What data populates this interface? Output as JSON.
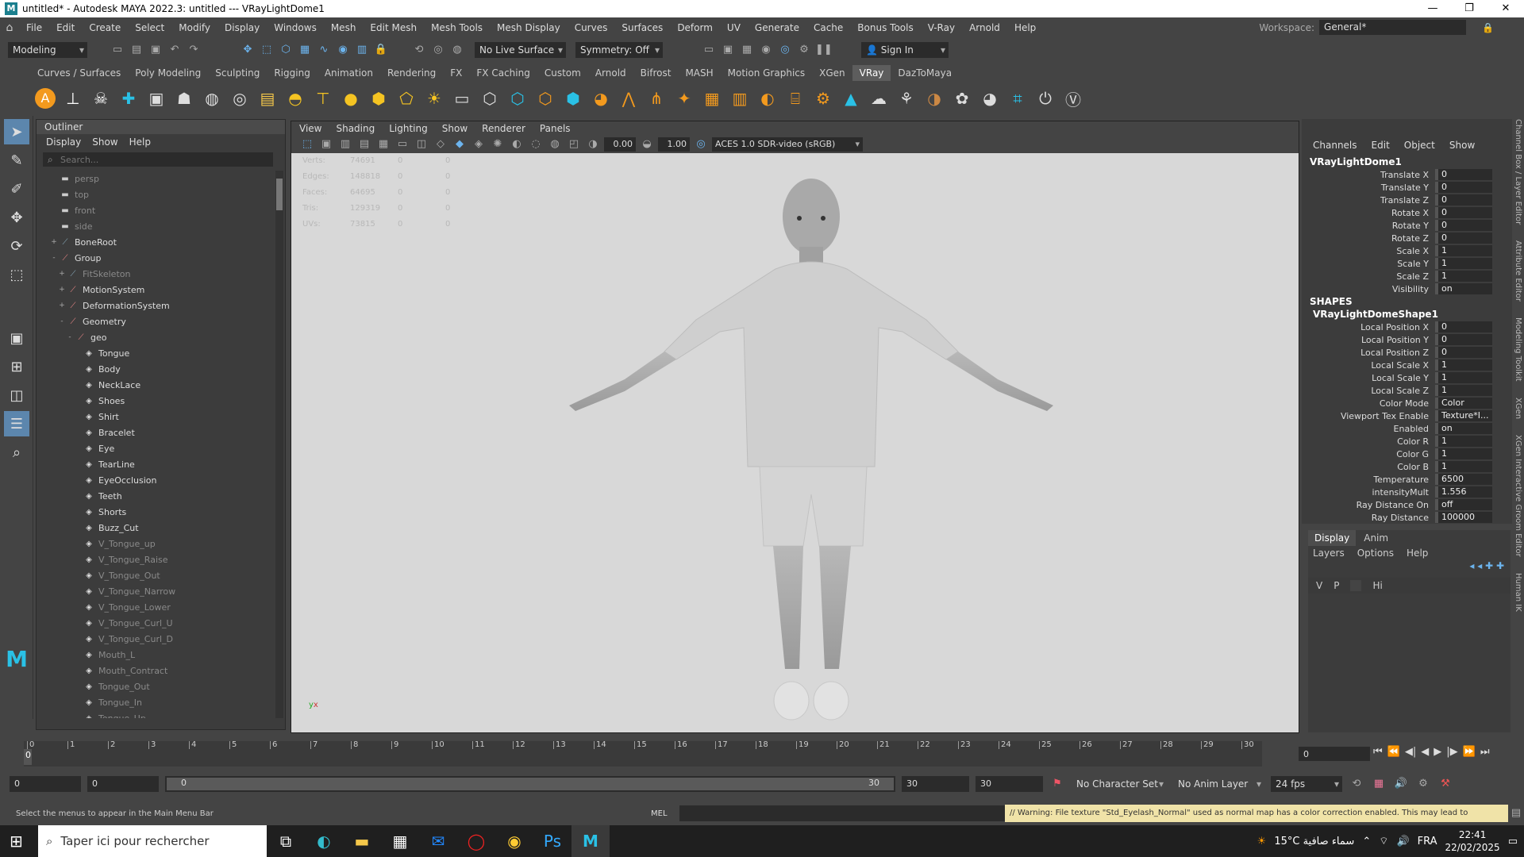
{
  "title": {
    "text": "untitled* - Autodesk MAYA 2022.3: untitled   ---   VRayLightDome1"
  },
  "menu": [
    "File",
    "Edit",
    "Create",
    "Select",
    "Modify",
    "Display",
    "Windows",
    "Mesh",
    "Edit Mesh",
    "Mesh Tools",
    "Mesh Display",
    "Curves",
    "Surfaces",
    "Deform",
    "UV",
    "Generate",
    "Cache",
    "Bonus Tools",
    "V-Ray",
    "Arnold",
    "Help"
  ],
  "workspace": {
    "label": "Workspace:",
    "value": "General*"
  },
  "status": {
    "menuset": "Modeling",
    "live": "No Live Surface",
    "symmetry": "Symmetry: Off",
    "signin": "Sign In"
  },
  "shelf_tabs": [
    "Curves / Surfaces",
    "Poly Modeling",
    "Sculpting",
    "Rigging",
    "Animation",
    "Rendering",
    "FX",
    "FX Caching",
    "Custom",
    "Arnold",
    "Bifrost",
    "MASH",
    "Motion Graphics",
    "XGen",
    "VRay",
    "DazToMaya"
  ],
  "shelf_active": "VRay",
  "outliner": {
    "title": "Outliner",
    "menus": [
      "Display",
      "Show",
      "Help"
    ],
    "search_placeholder": "Search...",
    "items": [
      {
        "label": "persp",
        "indent": 1,
        "icon": "camera",
        "dim": true
      },
      {
        "label": "top",
        "indent": 1,
        "icon": "camera",
        "dim": true
      },
      {
        "label": "front",
        "indent": 1,
        "icon": "camera",
        "dim": true
      },
      {
        "label": "side",
        "indent": 1,
        "icon": "camera",
        "dim": true
      },
      {
        "label": "BoneRoot",
        "indent": 1,
        "icon": "joint",
        "exp": "+"
      },
      {
        "label": "Group",
        "indent": 1,
        "icon": "group",
        "exp": "-"
      },
      {
        "label": "FitSkeleton",
        "indent": 2,
        "icon": "joint",
        "exp": "+",
        "dim": true
      },
      {
        "label": "MotionSystem",
        "indent": 2,
        "icon": "group",
        "exp": "+"
      },
      {
        "label": "DeformationSystem",
        "indent": 2,
        "icon": "group",
        "exp": "+"
      },
      {
        "label": "Geometry",
        "indent": 2,
        "icon": "group",
        "exp": "-"
      },
      {
        "label": "geo",
        "indent": 3,
        "icon": "group",
        "exp": "-"
      },
      {
        "label": "Tongue",
        "indent": 4,
        "icon": "mesh"
      },
      {
        "label": "Body",
        "indent": 4,
        "icon": "mesh"
      },
      {
        "label": "NeckLace",
        "indent": 4,
        "icon": "mesh"
      },
      {
        "label": "Shoes",
        "indent": 4,
        "icon": "mesh"
      },
      {
        "label": "Shirt",
        "indent": 4,
        "icon": "mesh"
      },
      {
        "label": "Bracelet",
        "indent": 4,
        "icon": "mesh"
      },
      {
        "label": "Eye",
        "indent": 4,
        "icon": "mesh"
      },
      {
        "label": "TearLine",
        "indent": 4,
        "icon": "mesh"
      },
      {
        "label": "EyeOcclusion",
        "indent": 4,
        "icon": "mesh"
      },
      {
        "label": "Teeth",
        "indent": 4,
        "icon": "mesh"
      },
      {
        "label": "Shorts",
        "indent": 4,
        "icon": "mesh"
      },
      {
        "label": "Buzz_Cut",
        "indent": 4,
        "icon": "mesh"
      },
      {
        "label": "V_Tongue_up",
        "indent": 4,
        "icon": "mesh",
        "dim": true
      },
      {
        "label": "V_Tongue_Raise",
        "indent": 4,
        "icon": "mesh",
        "dim": true
      },
      {
        "label": "V_Tongue_Out",
        "indent": 4,
        "icon": "mesh",
        "dim": true
      },
      {
        "label": "V_Tongue_Narrow",
        "indent": 4,
        "icon": "mesh",
        "dim": true
      },
      {
        "label": "V_Tongue_Lower",
        "indent": 4,
        "icon": "mesh",
        "dim": true
      },
      {
        "label": "V_Tongue_Curl_U",
        "indent": 4,
        "icon": "mesh",
        "dim": true
      },
      {
        "label": "V_Tongue_Curl_D",
        "indent": 4,
        "icon": "mesh",
        "dim": true
      },
      {
        "label": "Mouth_L",
        "indent": 4,
        "icon": "mesh",
        "dim": true
      },
      {
        "label": "Mouth_Contract",
        "indent": 4,
        "icon": "mesh",
        "dim": true
      },
      {
        "label": "Tongue_Out",
        "indent": 4,
        "icon": "mesh",
        "dim": true
      },
      {
        "label": "Tongue_In",
        "indent": 4,
        "icon": "mesh",
        "dim": true
      },
      {
        "label": "Tongue_Up",
        "indent": 4,
        "icon": "mesh",
        "dim": true
      }
    ]
  },
  "viewport": {
    "menus": [
      "View",
      "Shading",
      "Lighting",
      "Show",
      "Renderer",
      "Panels"
    ],
    "val1": "0.00",
    "val2": "1.00",
    "colorspace": "ACES 1.0 SDR-video (sRGB)",
    "hud": [
      [
        "Verts:",
        "74691",
        "0",
        "0"
      ],
      [
        "Edges:",
        "148818",
        "0",
        "0"
      ],
      [
        "Faces:",
        "64695",
        "0",
        "0"
      ],
      [
        "Tris:",
        "129319",
        "0",
        "0"
      ],
      [
        "UVs:",
        "73815",
        "0",
        "0"
      ]
    ]
  },
  "channel": {
    "menus": [
      "Channels",
      "Edit",
      "Object",
      "Show"
    ],
    "object": "VRayLightDome1",
    "attrs": [
      [
        "Translate X",
        "0"
      ],
      [
        "Translate Y",
        "0"
      ],
      [
        "Translate Z",
        "0"
      ],
      [
        "Rotate X",
        "0"
      ],
      [
        "Rotate Y",
        "0"
      ],
      [
        "Rotate Z",
        "0"
      ],
      [
        "Scale X",
        "1"
      ],
      [
        "Scale Y",
        "1"
      ],
      [
        "Scale Z",
        "1"
      ],
      [
        "Visibility",
        "on"
      ]
    ],
    "shapes_label": "SHAPES",
    "shape": "VRayLightDomeShape1",
    "shape_attrs": [
      [
        "Local Position X",
        "0"
      ],
      [
        "Local Position Y",
        "0"
      ],
      [
        "Local Position Z",
        "0"
      ],
      [
        "Local Scale X",
        "1"
      ],
      [
        "Local Scale Y",
        "1"
      ],
      [
        "Local Scale Z",
        "1"
      ],
      [
        "Color Mode",
        "Color"
      ],
      [
        "Viewport Tex Enable",
        "Texture*I..."
      ],
      [
        "Enabled",
        "on"
      ],
      [
        "Color R",
        "1"
      ],
      [
        "Color G",
        "1"
      ],
      [
        "Color B",
        "1"
      ],
      [
        "Temperature",
        "6500"
      ],
      [
        "intensityMult",
        "1.556"
      ],
      [
        "Ray Distance On",
        "off"
      ],
      [
        "Ray Distance",
        "100000"
      ]
    ]
  },
  "layers": {
    "tabs": [
      "Display",
      "Anim"
    ],
    "menus": [
      "Layers",
      "Options",
      "Help"
    ],
    "row": {
      "v": "V",
      "p": "P",
      "name": "Hi"
    }
  },
  "side_tabs": [
    "Channel Box / Layer Editor",
    "Attribute Editor",
    "Modeling Toolkit",
    "XGen",
    "XGen Interactive Groom Editor",
    "Human IK"
  ],
  "timeline": {
    "ticks": [
      "0",
      "1",
      "2",
      "3",
      "4",
      "5",
      "6",
      "7",
      "8",
      "9",
      "10",
      "11",
      "12",
      "13",
      "14",
      "15",
      "16",
      "17",
      "18",
      "19",
      "20",
      "21",
      "22",
      "23",
      "24",
      "25",
      "26",
      "27",
      "28",
      "29",
      "30"
    ],
    "current": "0",
    "current_frame": "0"
  },
  "range": {
    "start": "0",
    "start2": "0",
    "bar_left": "0",
    "bar_right": "30",
    "end": "30",
    "end2": "30",
    "charset": "No Character Set",
    "animlayer": "No Anim Layer",
    "fps": "24 fps"
  },
  "help": {
    "text": "Select the menus to appear in the Main Menu Bar",
    "mel": "MEL",
    "warning": "// Warning: File texture \"Std_Eyelash_Normal\" used as normal map has a color correction enabled. This may lead to"
  },
  "taskbar": {
    "search": "Taper ici pour rechercher",
    "weather": "15°C  سماء صافية",
    "lang": "FRA",
    "time": "22:41",
    "date": "22/02/2025"
  }
}
